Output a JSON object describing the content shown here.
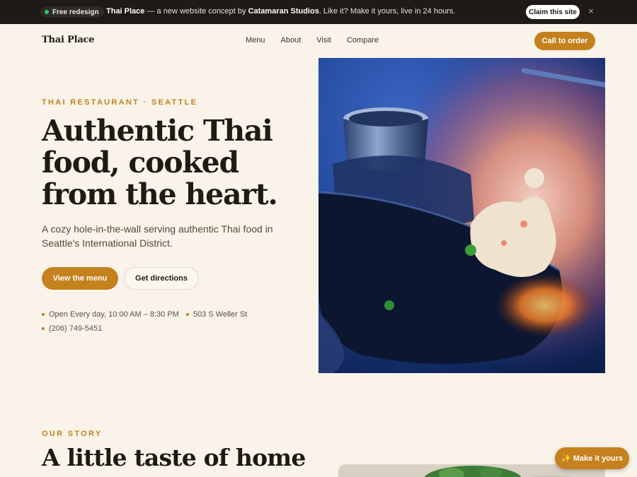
{
  "banner": {
    "badge": "Free redesign",
    "brand": "Thai Place",
    "text_mid": " — a new website concept by ",
    "studio": "Catamaran Studios",
    "text_end": ". Like it? Make it yours, live in 24 hours.",
    "claim_label": "Claim this site",
    "close_icon": "close-icon",
    "close_glyph": "×"
  },
  "nav": {
    "logo": "Thai Place",
    "links": [
      "Menu",
      "About",
      "Visit",
      "Compare"
    ],
    "cta": "Call to order"
  },
  "hero": {
    "eyebrow": "THAI RESTAURANT · SEATTLE",
    "title": "Authentic Thai food, cooked from the heart.",
    "subtitle": "A cozy hole-in-the-wall serving authentic Thai food in Seattle's International District.",
    "primary_button": "View the menu",
    "secondary_button": "Get directions",
    "hours": "Open Every day, 10:00 AM – 8:30 PM",
    "address": "503 S Weller St",
    "phone": "(206) 749-5451"
  },
  "story": {
    "eyebrow": "OUR STORY",
    "title": "A little taste of home"
  },
  "floating": {
    "make_label": "✨ Make it yours"
  },
  "colors": {
    "accent": "#c4811d",
    "banner_bg": "#1d1a17",
    "page_bg": "#f9f3e9",
    "text_dark": "#1f1a15"
  }
}
